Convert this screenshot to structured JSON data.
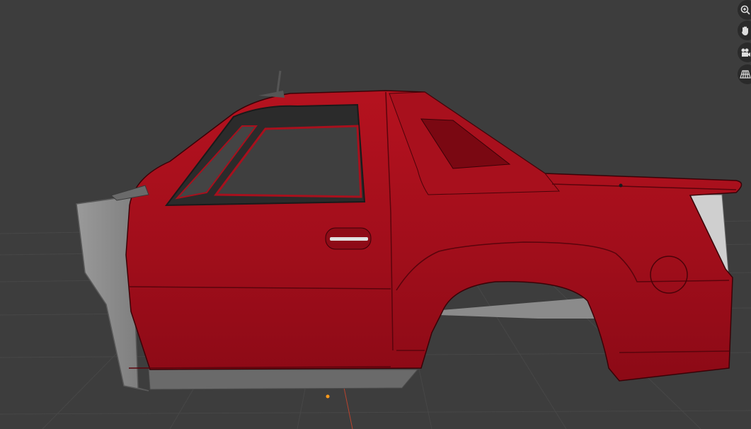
{
  "app": "3D Viewport",
  "viewport": {
    "background_color": "#3d3d3d",
    "grid_color": "#4a4a4a",
    "model_color": "#a80f1e",
    "model_shadow_color": "#7a0812",
    "model_highlight_color": "#c41a2a",
    "unpainted_part_color": "#8a8a8a",
    "origin_marker_color": "#ff9a1a"
  },
  "navigation_gizmo": {
    "buttons": [
      {
        "icon": "zoom-icon"
      },
      {
        "icon": "hand-pan-icon"
      },
      {
        "icon": "camera-icon"
      },
      {
        "icon": "perspective-grid-icon"
      }
    ]
  }
}
